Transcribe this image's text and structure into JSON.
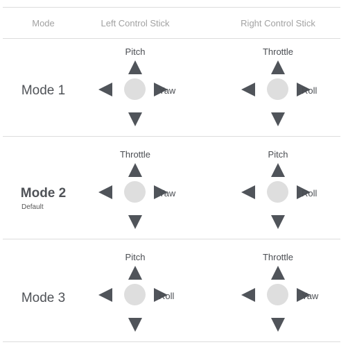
{
  "header": {
    "mode": "Mode",
    "left_stick": "Left Control Stick",
    "right_stick": "Right Control Stick"
  },
  "modes": [
    {
      "name": "Mode 1",
      "subtitle": "",
      "bold": false,
      "left": {
        "top": "Pitch",
        "right": "Yaw"
      },
      "right": {
        "top": "Throttle",
        "right": "Roll"
      }
    },
    {
      "name": "Mode 2",
      "subtitle": "Default",
      "bold": true,
      "left": {
        "top": "Throttle",
        "right": "Yaw"
      },
      "right": {
        "top": "Pitch",
        "right": "Roll"
      }
    },
    {
      "name": "Mode 3",
      "subtitle": "",
      "bold": false,
      "left": {
        "top": "Pitch",
        "right": "Roll"
      },
      "right": {
        "top": "Throttle",
        "right": "Yaw"
      }
    }
  ],
  "icons": {
    "arrow_up": "triangle-up",
    "arrow_down": "triangle-down",
    "arrow_left": "triangle-left",
    "arrow_right": "triangle-right",
    "stick_knob": "circle"
  },
  "colors": {
    "arrow": "#50545a",
    "knob": "#dedede",
    "divider": "#dcdcdc",
    "header_text": "#a2a2a2"
  }
}
